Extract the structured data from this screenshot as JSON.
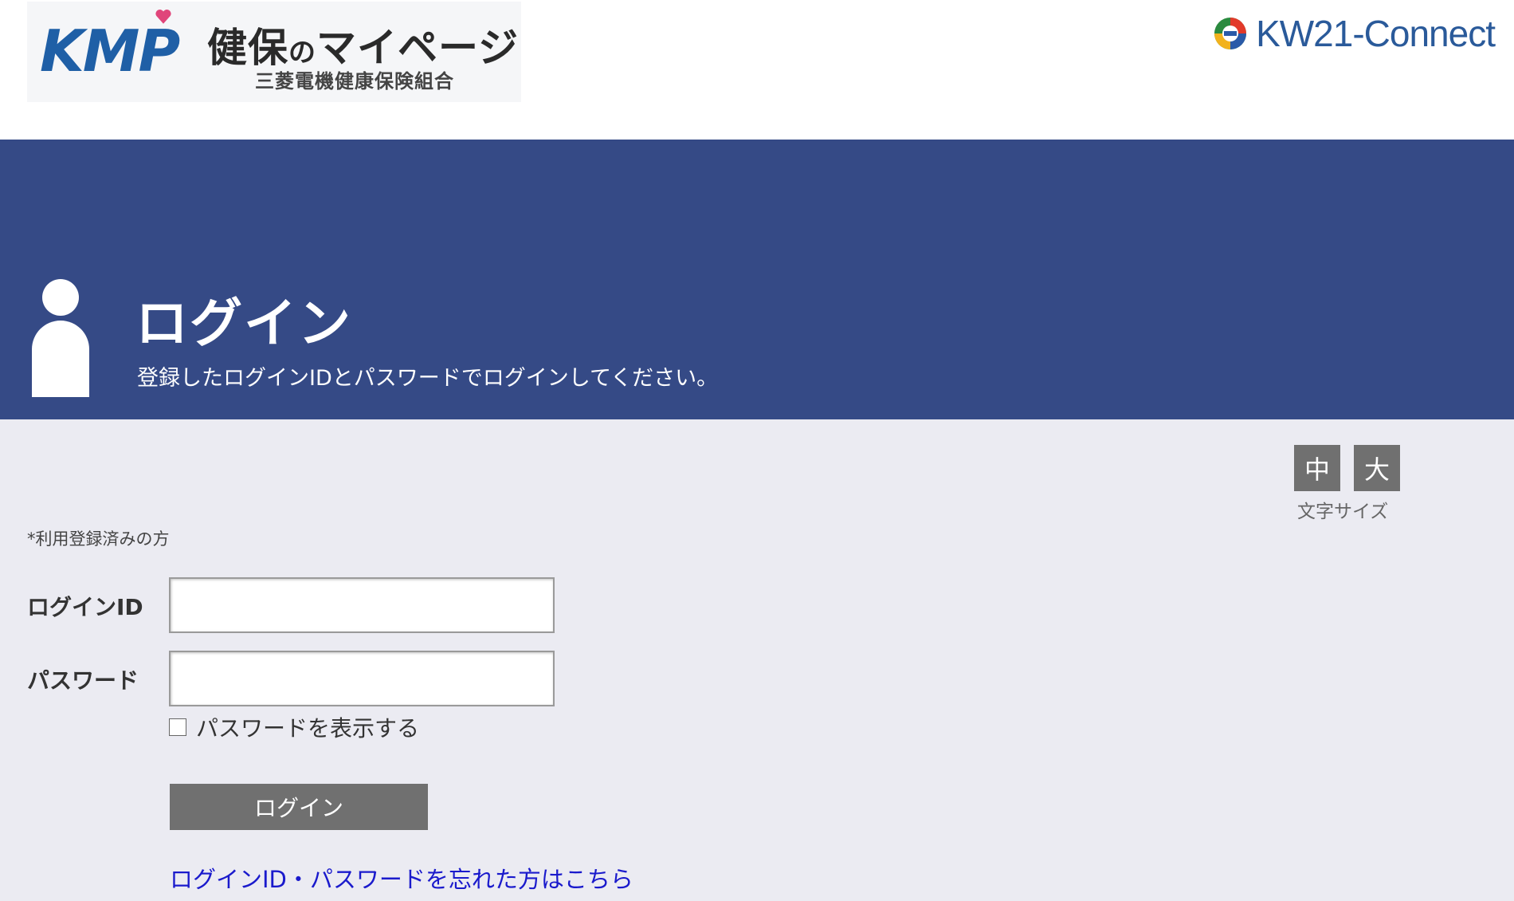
{
  "header": {
    "kmp_logo": {
      "letters": "KMP",
      "title_a": "健保",
      "title_no": "の",
      "title_b": "マイページ",
      "subtitle": "三菱電機健康保険組合"
    },
    "kw_logo": {
      "text": "KW21-Connect"
    }
  },
  "banner": {
    "title": "ログイン",
    "subtitle": "登録したログインIDとパスワードでログインしてください。"
  },
  "font_size": {
    "medium_label": "中",
    "large_label": "大",
    "caption": "文字サイズ"
  },
  "form": {
    "note": "*利用登録済みの方",
    "login_id_label": "ログインID",
    "login_id_value": "",
    "password_label": "パスワード",
    "password_value": "",
    "show_password_label": "パスワードを表示する",
    "show_password_checked": false,
    "login_button": "ログイン",
    "forgot_link": "ログインID・パスワードを忘れた方はこちら"
  },
  "colors": {
    "banner": "#354a86",
    "page_bg": "#ebebf2",
    "button": "#707070",
    "link": "#1a1acc"
  }
}
